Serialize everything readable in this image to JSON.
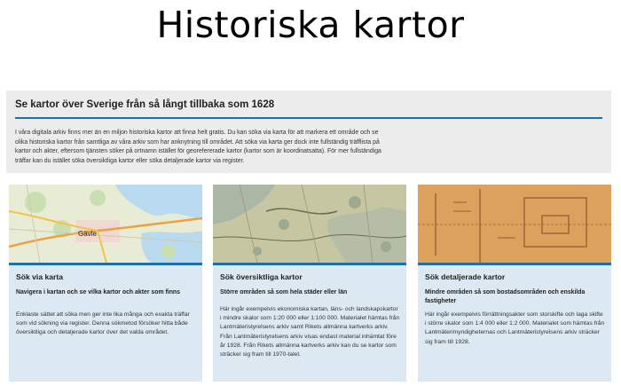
{
  "slide_title": "Historiska kartor",
  "intro": {
    "heading": "Se kartor över Sverige från så långt tillbaka som 1628",
    "body": "I våra digitala arkiv finns mer än en miljon historiska kartor att finna helt gratis. Du kan söka via karta för att markera ett område och se olika historiska kartor från samtliga av våra arkiv som har anknytning till området. Att söka via karta ger dock inte fullständig träfflista på kartor och akter, eftersom tjänsten söker på ortnamn istället för georefererade kartor (kartor som är koordinatsatta). För mer fullständiga träffar kan du istället söka översiktliga kartor eller söka detaljerade kartor via register."
  },
  "cards": [
    {
      "title": "Sök via karta",
      "subtitle": "Navigera i kartan och se vilka kartor och akter som finns",
      "text": "Enklaste sättet att söka men ger inte lika många och exakta träffar som vid sökning via register. Denna sökmetod försöker hitta både översiktliga och detaljerade kartor över det valda området.",
      "map_label": "Gävle"
    },
    {
      "title": "Sök översiktliga kartor",
      "subtitle": "Större områden så som hela städer eller län",
      "text": "Här ingår exempelvis ekonomiska kartan, läns- och landskapskartor i mindre skalor som 1:20 000 eller 1:100 000. Materialet hämtas från Lantmäteristyrelsens arkiv samt Rikets allmänna kartverks arkiv. Från Lantmäteristyrelsens arkiv visas endast material inhämtat före år 1928. Från Rikets allmänna kartverks arkiv kan du se kartor som sträcker sig fram till 1970-talet."
    },
    {
      "title": "Sök detaljerade kartor",
      "subtitle": "Mindre områden så som bostadsområden och enskilda fastigheter",
      "text": "Här ingår exempelvis förrättningsakter som storskifte och laga skifte i större skalor som 1:4 000 eller 1:2 000. Materialet som hämtas från Lantmäterimyndigheternas och Lantmäteristyrelsens arkiv sträcker sig fram till 1928."
    }
  ],
  "colors": {
    "accent": "#1f6fa8",
    "card_bg": "#dce9f2",
    "panel_bg": "#ececec"
  }
}
